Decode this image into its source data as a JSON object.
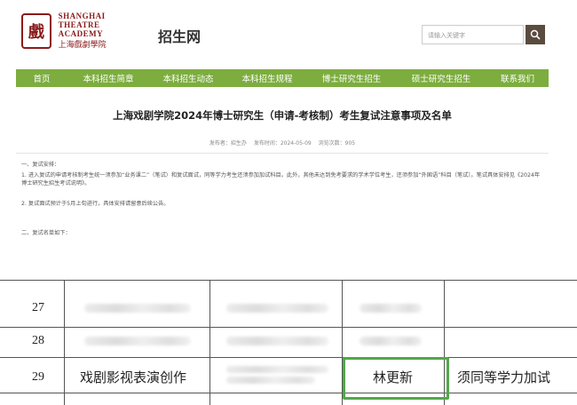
{
  "header": {
    "logo_en_line1": "SHANGHAI",
    "logo_en_line2": "THEATRE ACADEMY",
    "logo_cn": "上海戲劇學院",
    "logo_seal": "戲",
    "site_title": "招生网",
    "search_placeholder": "请输入关键字",
    "search_icon": "search-icon"
  },
  "nav": {
    "items": [
      "首页",
      "本科招生简章",
      "本科招生动态",
      "本科招生规程",
      "博士研究生招生",
      "硕士研究生招生",
      "联系我们"
    ]
  },
  "article": {
    "title": "上海戏剧学院2024年博士研究生（申请-考核制）考生复试注意事项及名单",
    "meta_publisher": "发布者：招生办",
    "meta_date": "发布时间：2024-05-09",
    "meta_views": "浏览次数：905",
    "p1": "一、复试安排：",
    "p2": "1. 进入复试的申请考核制考生统一须参加“业务课二”（笔试）和复试面试，同等学力考生还须参加加试科目。此外，其他未达到免考要求的学术学位考生，还须参加“外国语”科目（笔试）。笔试具体安排见《2024年博士研究生招生考试说明》。",
    "p3": "2. 复试面试预计于5月上旬进行，具体安排请留意后续公告。",
    "p4": "二、复试名单如下："
  },
  "table": {
    "rows": [
      {
        "num": "27",
        "major": "",
        "name": "",
        "note": ""
      },
      {
        "num": "28",
        "major": "",
        "name": "",
        "note": ""
      },
      {
        "num": "29",
        "major": "戏剧影视表演创作",
        "name": "林更新",
        "note": "须同等学力加试"
      }
    ]
  },
  "colors": {
    "nav_bg": "#7cad3e",
    "brand": "#8b1a1a",
    "highlight": "#52a84a",
    "search_btn": "#5a4b3f"
  }
}
